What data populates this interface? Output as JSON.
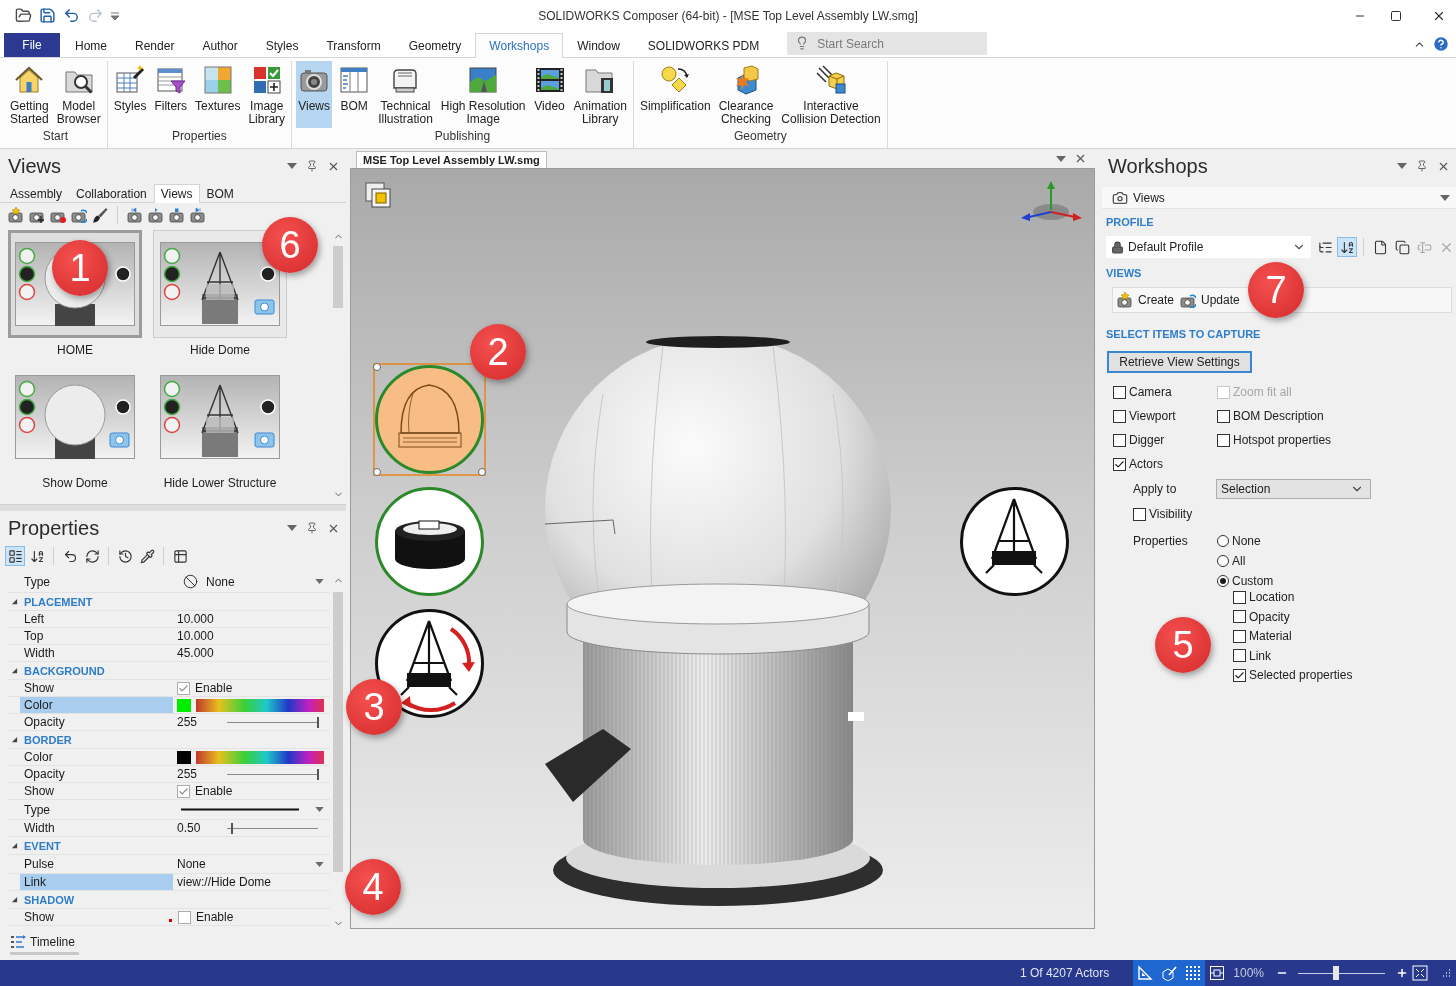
{
  "window": {
    "title": "SOLIDWORKS Composer (64-bit) - [MSE Top Level Assembly LW.smg]"
  },
  "quick_access": [
    {
      "disabled": false
    },
    {
      "disabled": false
    },
    {
      "disabled": false
    },
    {
      "disabled": true
    }
  ],
  "ribbon_tabs": [
    {
      "label": "File",
      "kind": "file",
      "selected": false
    },
    {
      "label": "Home",
      "kind": "tab",
      "selected": false
    },
    {
      "label": "Render",
      "kind": "tab",
      "selected": false
    },
    {
      "label": "Author",
      "kind": "tab",
      "selected": false
    },
    {
      "label": "Styles",
      "kind": "tab",
      "selected": false
    },
    {
      "label": "Transform",
      "kind": "tab",
      "selected": false
    },
    {
      "label": "Geometry",
      "kind": "tab",
      "selected": false
    },
    {
      "label": "Workshops",
      "kind": "tab",
      "selected": true
    },
    {
      "label": "Window",
      "kind": "tab",
      "selected": false
    },
    {
      "label": "SOLIDWORKS PDM",
      "kind": "tab",
      "selected": false
    }
  ],
  "search": {
    "placeholder": "Start Search"
  },
  "ribbon_groups": [
    {
      "title": "Start",
      "buttons": [
        {
          "label": "Getting\nStarted",
          "selected": false
        },
        {
          "label": "Model\nBrowser",
          "selected": false
        }
      ]
    },
    {
      "title": "Properties",
      "buttons": [
        {
          "label": "Styles",
          "selected": false
        },
        {
          "label": "Filters",
          "selected": false
        },
        {
          "label": "Textures",
          "selected": false
        },
        {
          "label": "Image\nLibrary",
          "selected": false
        }
      ]
    },
    {
      "title": "Publishing",
      "buttons": [
        {
          "label": "Views",
          "selected": true
        },
        {
          "label": "BOM",
          "selected": false
        },
        {
          "label": "Technical\nIllustration",
          "selected": false
        },
        {
          "label": "High Resolution\nImage",
          "selected": false
        },
        {
          "label": "Video",
          "selected": false
        },
        {
          "label": "Animation\nLibrary",
          "selected": false
        }
      ]
    },
    {
      "title": "Geometry",
      "buttons": [
        {
          "label": "Simplification",
          "selected": false
        },
        {
          "label": "Clearance\nChecking",
          "selected": false
        },
        {
          "label": "Interactive\nCollision Detection",
          "selected": false
        }
      ]
    }
  ],
  "views_panel": {
    "title": "Views",
    "tabs": [
      {
        "label": "Assembly",
        "selected": false
      },
      {
        "label": "Collaboration",
        "selected": false
      },
      {
        "label": "Views",
        "selected": true
      },
      {
        "label": "BOM",
        "selected": false
      }
    ],
    "views": [
      {
        "label": "HOME",
        "selected": true,
        "hovered": false
      },
      {
        "label": "Hide Dome",
        "selected": false,
        "hovered": true
      },
      {
        "label": "Show Dome",
        "selected": false,
        "hovered": false
      },
      {
        "label": "Hide Lower Structure",
        "selected": false,
        "hovered": false
      }
    ]
  },
  "properties_panel": {
    "title": "Properties",
    "tools": [
      {
        "selected": true
      },
      {
        "selected": false
      },
      {
        "selected": false
      },
      {
        "selected": false
      },
      {
        "selected": false
      },
      {
        "selected": false
      },
      {
        "selected": false
      }
    ],
    "rows": [
      {
        "kind": "icon_dropdown",
        "label": "Type",
        "value": "None",
        "selected": false,
        "flagged": false
      },
      {
        "kind": "section",
        "label": "PLACEMENT",
        "expanded": true
      },
      {
        "kind": "text",
        "label": "Left",
        "value": "10.000",
        "selected": false,
        "flagged": false
      },
      {
        "kind": "text",
        "label": "Top",
        "value": "10.000",
        "selected": false,
        "flagged": false
      },
      {
        "kind": "text",
        "label": "Width",
        "value": "45.000",
        "selected": false,
        "flagged": false
      },
      {
        "kind": "section",
        "label": "BACKGROUND",
        "expanded": true
      },
      {
        "kind": "check",
        "label": "Show",
        "value": "Enable",
        "checked": true,
        "selected": false,
        "flagged": false
      },
      {
        "kind": "color",
        "label": "Color",
        "color": "#00ee00",
        "selected": true,
        "flagged": false
      },
      {
        "kind": "slider",
        "label": "Opacity",
        "value": "255",
        "level": 1,
        "selected": false,
        "flagged": false
      },
      {
        "kind": "section",
        "label": "BORDER",
        "expanded": true
      },
      {
        "kind": "color",
        "label": "Color",
        "color": "#000000",
        "selected": false,
        "flagged": false
      },
      {
        "kind": "slider",
        "label": "Opacity",
        "value": "255",
        "level": 1,
        "selected": false,
        "flagged": false
      },
      {
        "kind": "check",
        "label": "Show",
        "value": "Enable",
        "checked": true,
        "selected": false,
        "flagged": false
      },
      {
        "kind": "line",
        "label": "Type",
        "selected": false,
        "flagged": false
      },
      {
        "kind": "slider",
        "label": "Width",
        "value": "0.50",
        "level": 0.05,
        "selected": false,
        "flagged": false
      },
      {
        "kind": "section",
        "label": "EVENT",
        "expanded": true
      },
      {
        "kind": "dropdown",
        "label": "Pulse",
        "value": "None",
        "selected": false,
        "flagged": false
      },
      {
        "kind": "text",
        "label": "Link",
        "value": "view://Hide Dome",
        "selected": true,
        "flagged": false
      },
      {
        "kind": "section",
        "label": "SHADOW",
        "expanded": true
      },
      {
        "kind": "check",
        "label": "Show",
        "value": "Enable",
        "checked": false,
        "selected": false,
        "flagged": true
      }
    ]
  },
  "timeline_tab": {
    "label": "Timeline"
  },
  "document": {
    "tab": "MSE Top Level Assembly LW.smg",
    "annotations": [
      {
        "selected": true
      },
      {
        "selected": false
      },
      {
        "selected": false
      },
      {
        "selected": false
      }
    ]
  },
  "workshops_panel": {
    "title": "Workshops",
    "workshop": "Views",
    "profile_heading": "PROFILE",
    "profile": "Default Profile",
    "profile_tools": [
      {
        "selected": false,
        "disabled": false
      },
      {
        "selected": true,
        "disabled": false
      },
      {
        "selected": false,
        "disabled": false
      },
      {
        "selected": false,
        "disabled": false
      },
      {
        "selected": false,
        "disabled": true
      },
      {
        "selected": false,
        "disabled": true
      }
    ],
    "views_heading": "VIEWS",
    "view_actions": [
      {
        "label": "Create"
      },
      {
        "label": "Update"
      }
    ],
    "capture_heading": "SELECT ITEMS TO CAPTURE",
    "retrieve_button": "Retrieve View Settings",
    "capture_items": [
      {
        "label": "Camera",
        "checked": false,
        "disabled": false
      },
      {
        "label": "Zoom fit all",
        "checked": false,
        "disabled": true
      },
      {
        "label": "Viewport",
        "checked": false,
        "disabled": false
      },
      {
        "label": "BOM Description",
        "checked": false,
        "disabled": false
      },
      {
        "label": "Digger",
        "checked": false,
        "disabled": false
      },
      {
        "label": "Hotspot properties",
        "checked": false,
        "disabled": false
      },
      {
        "label": "Actors",
        "checked": true,
        "disabled": false
      }
    ],
    "apply_to": {
      "label": "Apply to",
      "value": "Selection"
    },
    "visibility": {
      "label": "Visibility",
      "checked": false
    },
    "properties_label": "Properties",
    "property_modes": [
      {
        "label": "None",
        "selected": false
      },
      {
        "label": "All",
        "selected": false
      },
      {
        "label": "Custom",
        "selected": true
      }
    ],
    "custom_properties": [
      {
        "label": "Location",
        "checked": false
      },
      {
        "label": "Opacity",
        "checked": false
      },
      {
        "label": "Material",
        "checked": false
      },
      {
        "label": "Link",
        "checked": false
      },
      {
        "label": "Selected properties",
        "checked": true
      }
    ]
  },
  "status_bar": {
    "actors": "1 Of 4207 Actors",
    "tools": [
      {
        "selected": true
      },
      {
        "selected": true
      },
      {
        "selected": true
      },
      {
        "selected": false
      }
    ],
    "zoom": "100%",
    "zoom_slider": {
      "level": 0.44
    }
  },
  "callouts": [
    {
      "label": "1"
    },
    {
      "label": "2"
    },
    {
      "label": "3"
    },
    {
      "label": "4"
    },
    {
      "label": "5"
    },
    {
      "label": "6"
    },
    {
      "label": "7"
    }
  ]
}
